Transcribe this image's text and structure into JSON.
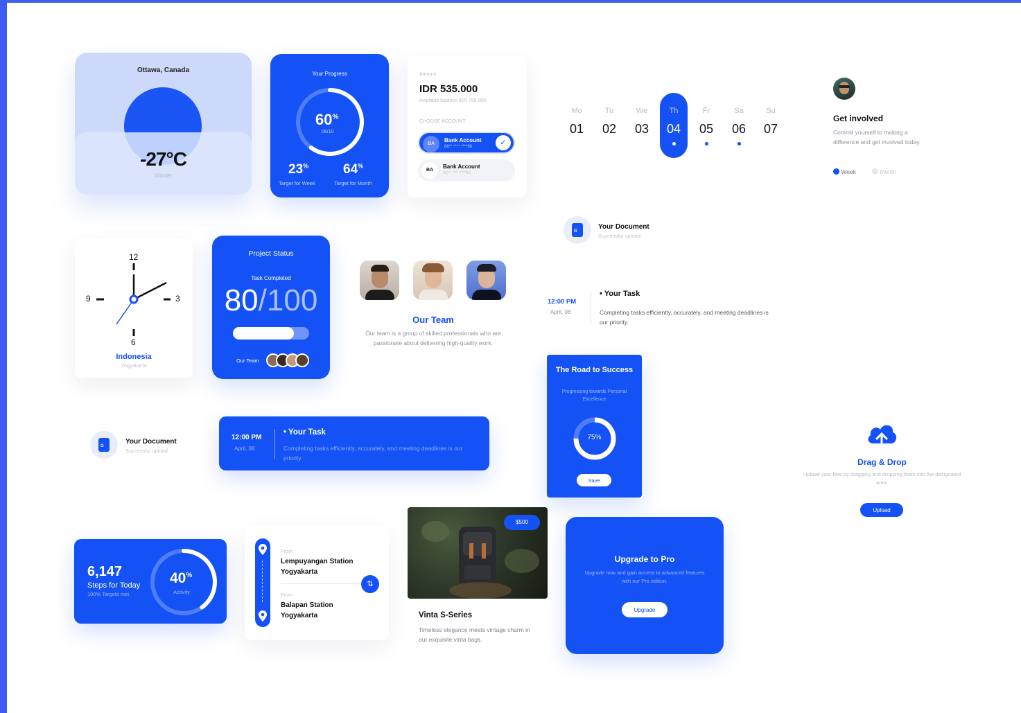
{
  "weather": {
    "city": "Ottawa, Canada",
    "temperature": "-27°C",
    "season": "Winter"
  },
  "progress": {
    "title": "Your Progress",
    "main_pct": "60",
    "pct_sign": "%",
    "main_sub": "06/10",
    "main_fraction": 0.6,
    "week_pct": "23",
    "week_label": "Target for Week",
    "month_pct": "64",
    "month_label": "Target for Month"
  },
  "amount": {
    "label": "Amount",
    "value": "IDR 535.000",
    "balance": "Available balance IDR 795.000",
    "choose": "CHOOSE ACCOUNT",
    "accounts": [
      {
        "badge": "BA",
        "name": "Bank Account",
        "number": "88** **** ****98"
      },
      {
        "badge": "BA",
        "name": "Bank Account",
        "number": "88** **** ****98"
      }
    ]
  },
  "calendar": {
    "days": [
      {
        "name": "Mo",
        "num": "01"
      },
      {
        "name": "Tu",
        "num": "02"
      },
      {
        "name": "We",
        "num": "03"
      },
      {
        "name": "Th",
        "num": "04"
      },
      {
        "name": "Fr",
        "num": "05"
      },
      {
        "name": "Sa",
        "num": "06"
      },
      {
        "name": "Su",
        "num": "07"
      }
    ]
  },
  "involved": {
    "title": "Get involved",
    "text": "Commit yourself to making a difference and get involved today.",
    "option_week": "Week",
    "option_month": "Month"
  },
  "document": {
    "title": "Your Document",
    "subtitle": "Successful upload",
    "icon_letter": "G"
  },
  "clock": {
    "n12": "12",
    "n3": "3",
    "n6": "6",
    "n9": "9",
    "country": "Indonesia",
    "city": "Yogyakarta"
  },
  "project": {
    "title": "Project Status",
    "task_label": "Task Completed",
    "done": "80",
    "slash": "/",
    "total": "100",
    "fraction": 0.8,
    "team_label": "Our Team"
  },
  "team": {
    "title": "Our Team",
    "text": "Our team is a group of skilled professionals who are passionate about delivering high-quality work."
  },
  "task": {
    "time": "12:00 PM",
    "date": "April, 08",
    "title": "• Your Task",
    "text": "Completing tasks efficiently, accurately, and meeting deadlines is our priority."
  },
  "road": {
    "title": "The Road to Success",
    "subtitle": "Progressing towards Personal Excellence",
    "pct": "75%",
    "fraction": 0.75,
    "button": "Save"
  },
  "dragdrop": {
    "title": "Drag & Drop",
    "text": "Upload your files by dragging and dropping them into the designated area.",
    "button": "Upload"
  },
  "steps": {
    "count": "6,147",
    "label": "Steps for Today",
    "sub": "100% Targets met",
    "pct": "40",
    "pct_sign": "%",
    "pct_label": "Activity",
    "fraction": 0.4
  },
  "route": {
    "from_label": "From",
    "from_station": "Lempuyangan Station",
    "from_city": "Yogyakarta",
    "to_label": "From",
    "to_station": "Balapan Station",
    "to_city": "Yogyakarta"
  },
  "product": {
    "price": "$500",
    "title": "Vinta S-Series",
    "text": "Timeless elegance meets vintage charm in our exquisite vinta bags."
  },
  "upgrade": {
    "title": "Upgrade to Pro",
    "text": "Upgrade now and gain access to advanced features with our Pro edition.",
    "button": "Upgrade"
  }
}
